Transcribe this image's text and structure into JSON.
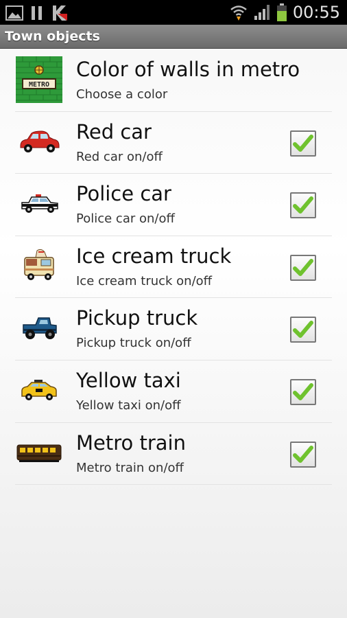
{
  "status_bar": {
    "time": "00:55",
    "icons": [
      "image-icon",
      "pause-icon",
      "kaspersky-icon",
      "wifi-icon",
      "signal-icon",
      "battery-icon"
    ]
  },
  "title_bar": {
    "title": "Town objects"
  },
  "items": [
    {
      "icon": "metro-wall-icon",
      "title": "Color of walls in metro",
      "subtitle": "Choose a color",
      "checkbox": null,
      "icon_text": "METRO"
    },
    {
      "icon": "red-car-icon",
      "title": "Red car",
      "subtitle": "Red car on/off",
      "checked": true
    },
    {
      "icon": "police-car-icon",
      "title": "Police car",
      "subtitle": "Police car on/off",
      "checked": true
    },
    {
      "icon": "ice-cream-truck-icon",
      "title": "Ice cream truck",
      "subtitle": "Ice cream truck on/off",
      "checked": true
    },
    {
      "icon": "pickup-truck-icon",
      "title": "Pickup truck",
      "subtitle": "Pickup truck on/off",
      "checked": true
    },
    {
      "icon": "yellow-taxi-icon",
      "title": "Yellow taxi",
      "subtitle": "Yellow taxi on/off",
      "checked": true
    },
    {
      "icon": "metro-train-icon",
      "title": "Metro train",
      "subtitle": "Metro train on/off",
      "checked": true
    }
  ],
  "colors": {
    "check_green": "#6fc22e",
    "battery_green": "#8ec63f",
    "title_bar": "#7a7a7a"
  }
}
